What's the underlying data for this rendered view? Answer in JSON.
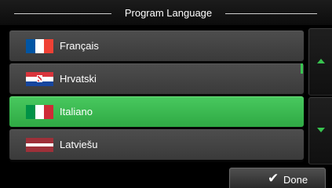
{
  "header": {
    "title": "Program Language"
  },
  "languages": [
    {
      "label": "Français",
      "flag": "france-flag",
      "colors": [
        "#0055a4",
        "#ffffff",
        "#ef4135"
      ]
    },
    {
      "label": "Hrvatski",
      "flag": "croatia-flag",
      "colors": [
        "#d9343b",
        "#ffffff",
        "#17469e"
      ]
    },
    {
      "label": "Italiano",
      "flag": "italy-flag",
      "colors": [
        "#009246",
        "#ffffff",
        "#ce2b37"
      ],
      "selected": true
    },
    {
      "label": "Latviešu",
      "flag": "latvia-flag",
      "colors": [
        "#9e3039",
        "#ffffff",
        "#9e3039"
      ]
    }
  ],
  "scroll": {
    "up_icon": "triangle-up-icon",
    "down_icon": "triangle-down-icon"
  },
  "footer": {
    "done_label": "Done",
    "done_icon": "checkmark-icon"
  },
  "colors": {
    "accent": "#38c34f",
    "selected_bg": "#3dbb52",
    "item_bg": "#444444"
  }
}
